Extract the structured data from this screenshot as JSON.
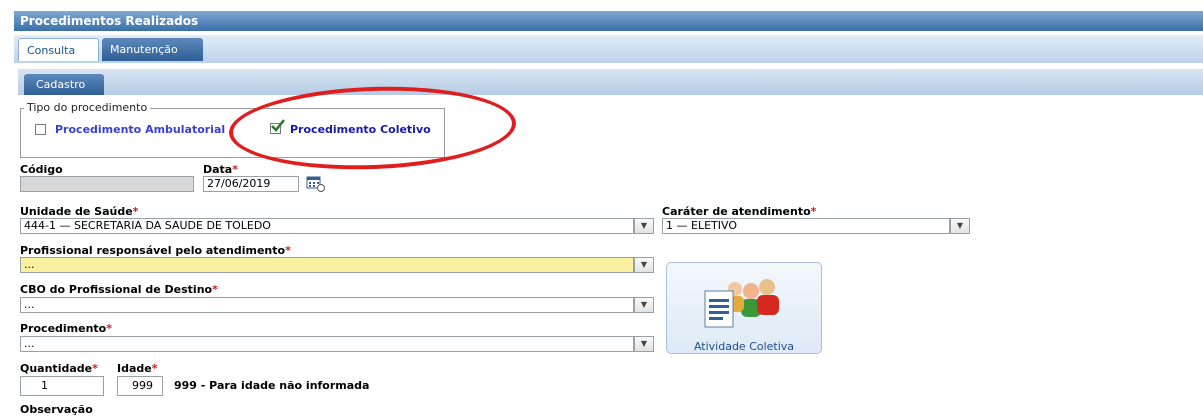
{
  "window": {
    "title": "Procedimentos Realizados"
  },
  "tabs": [
    {
      "label": "Consulta",
      "active": true
    },
    {
      "label": "Manutenção",
      "active": false
    }
  ],
  "subtab": {
    "label": "Cadastro"
  },
  "tipo": {
    "legend": "Tipo do procedimento",
    "options": [
      {
        "label": "Procedimento Ambulatorial",
        "checked": false
      },
      {
        "label": "Procedimento Coletivo",
        "checked": true
      }
    ]
  },
  "form": {
    "codigo": {
      "label": "Código",
      "value": ""
    },
    "data": {
      "label": "Data",
      "required": "*",
      "value": "27/06/2019"
    },
    "unidade": {
      "label": "Unidade de Saúde",
      "required": "*",
      "value": "444-1 — SECRETARIA DA SAUDE DE TOLEDO"
    },
    "carater": {
      "label": "Caráter de atendimento",
      "required": "*",
      "value": "1 — ELETIVO"
    },
    "profissional": {
      "label": "Profissional responsável pelo atendimento",
      "required": "*",
      "value": "..."
    },
    "cbo": {
      "label": "CBO do Profissional de Destino",
      "required": "*",
      "value": "..."
    },
    "procedimento": {
      "label": "Procedimento",
      "required": "*",
      "value": "..."
    },
    "quantidade": {
      "label": "Quantidade",
      "required": "*",
      "value": "1"
    },
    "idade": {
      "label": "Idade",
      "required": "*",
      "value": "999",
      "hint": "999 - Para idade não informada"
    },
    "observacao": {
      "label": "Observação"
    }
  },
  "atividade": {
    "label": "Atividade Coletiva",
    "icon": "group-document-icon"
  },
  "colors": {
    "accent": "#2f5f96",
    "highlight_field": "#f7f1a0",
    "annotation": "#e01e1e",
    "checkbox_label": "#3a40d0"
  }
}
